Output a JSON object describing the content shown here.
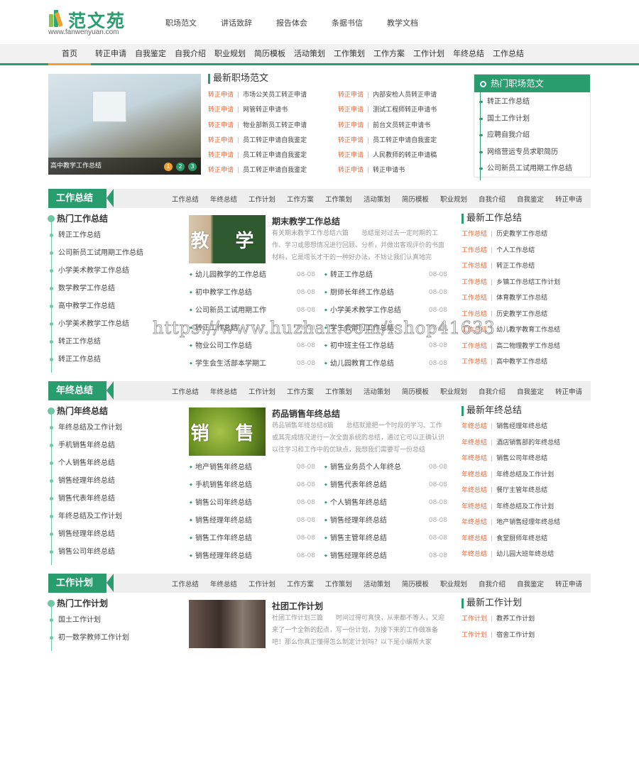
{
  "header": {
    "logo_text": "范文苑",
    "logo_url": "www.fanwenyuan.com",
    "top_nav": [
      "职场范文",
      "讲话致辞",
      "报告体会",
      "条据书信",
      "教学文档"
    ]
  },
  "main_nav": [
    "首页",
    "转正申请",
    "自我鉴定",
    "自我介绍",
    "职业规划",
    "简历模板",
    "活动策划",
    "工作策划",
    "工作方案",
    "工作计划",
    "年终总结",
    "工作总结"
  ],
  "slider": {
    "caption": "高中教学工作总结",
    "dots": [
      "1",
      "2",
      "3"
    ],
    "active_dot": 1
  },
  "latest_career": {
    "title": "最新职场范文",
    "rows": [
      {
        "tag": "转正申请",
        "text": "市场公关员工转正申请"
      },
      {
        "tag": "转正申请",
        "text": "内部安检人员转正申请"
      },
      {
        "tag": "转正申请",
        "text": "网管转正申请书"
      },
      {
        "tag": "转正申请",
        "text": "测试工程师转正申请书"
      },
      {
        "tag": "转正申请",
        "text": "物业部新员工转正申请"
      },
      {
        "tag": "转正申请",
        "text": "前台文员转正申请书"
      },
      {
        "tag": "转正申请",
        "text": "员工转正申请自我鉴定"
      },
      {
        "tag": "转正申请",
        "text": "员工转正申请自我鉴定"
      },
      {
        "tag": "转正申请",
        "text": "员工转正申请自我鉴定"
      },
      {
        "tag": "转正申请",
        "text": "人民教师的转正申请稿"
      },
      {
        "tag": "转正申请",
        "text": "员工转正申请自我鉴定"
      },
      {
        "tag": "转正申请",
        "text": "转正申请书"
      }
    ]
  },
  "hot_career": {
    "title": "热门职场范文",
    "items": [
      "转正工作总结",
      "国土工作计划",
      "应聘自我介绍",
      "网络营运专员求职简历",
      "公司新员工试用期工作总结"
    ]
  },
  "section_links": [
    "工作总结",
    "年终总结",
    "工作计划",
    "工作方案",
    "工作策划",
    "活动策划",
    "简历模板",
    "职业规划",
    "自我介绍",
    "自我鉴定",
    "转正申请"
  ],
  "sections": [
    {
      "label": "工作总结",
      "hot_title": "热门工作总结",
      "hot_items": [
        "转正工作总结",
        "公司新员工试用期工作总结",
        "小学美术教学工作总结",
        "数学教学工作总结",
        "高中教学工作总结",
        "小学美术教学工作总结",
        "转正工作总结",
        "转正工作总结"
      ],
      "feature": {
        "thumb_text": "教 学",
        "title": "期末教学工作总结",
        "desc": "有关期末教学工作总结六篇　　总结是对过去一定时期的工作、学习或思想情况进行回顾、分析，并做出客观评价的书面材料，它是增长才干的一种好办法，不妨让我们认真地完"
      },
      "items": [
        {
          "text": "幼儿园教学的工作总结",
          "date": "08-08"
        },
        {
          "text": "转正工作总结",
          "date": "08-08"
        },
        {
          "text": "初中教学工作总结",
          "date": "08-08"
        },
        {
          "text": "厨师长年终工作总结",
          "date": "08-08"
        },
        {
          "text": "公司新员工试用期工作",
          "date": "08-08"
        },
        {
          "text": "小学美术教学工作总结",
          "date": "08-08"
        },
        {
          "text": "转正工作总结",
          "date": "08-08"
        },
        {
          "text": "学生会部门工作总结",
          "date": "08-08"
        },
        {
          "text": "物业公司工作总结",
          "date": "08-08"
        },
        {
          "text": "初中班主任工作总结",
          "date": "08-08"
        },
        {
          "text": "学生会生活部本学期工",
          "date": "08-08"
        },
        {
          "text": "幼儿园教育工作总结",
          "date": "08-08"
        }
      ],
      "newest_title": "最新工作总结",
      "newest": [
        {
          "tag": "工作总结",
          "text": "历史教学工作总结"
        },
        {
          "tag": "工作总结",
          "text": "个人工作总结"
        },
        {
          "tag": "工作总结",
          "text": "转正工作总结"
        },
        {
          "tag": "工作总结",
          "text": "乡镇工作总结工作计划"
        },
        {
          "tag": "工作总结",
          "text": "体育教学工作总结"
        },
        {
          "tag": "工作总结",
          "text": "历史教学工作总结"
        },
        {
          "tag": "工作总结",
          "text": "幼儿教学教育工作总结"
        },
        {
          "tag": "工作总结",
          "text": "高二物理教学工作总结"
        },
        {
          "tag": "工作总结",
          "text": "高中教学工作总结"
        }
      ]
    },
    {
      "label": "年终总结",
      "hot_title": "热门年终总结",
      "hot_items": [
        "年终总结及工作计划",
        "手机销售年终总结",
        "个人销售年终总结",
        "销售经理年终总结",
        "销售代表年终总结",
        "年终总结及工作计划",
        "销售经理年终总结",
        "销售公司年终总结"
      ],
      "feature": {
        "thumb_text": "销 售",
        "title": "药品销售年终总结",
        "desc": "药品销售年终总结8篇　　总结就是把一个时段的学习、工作或其完成情况进行一次全面系统的总结，通过它可以正确认识以往学习和工作中的优缺点，我想我们需要写一份总结"
      },
      "items": [
        {
          "text": "地产销售年终总结",
          "date": "08-08"
        },
        {
          "text": "销售业务员个人年终总",
          "date": "08-08"
        },
        {
          "text": "手机销售年终总结",
          "date": "08-08"
        },
        {
          "text": "销售代表年终总结",
          "date": "08-08"
        },
        {
          "text": "销售公司年终总结",
          "date": "08-08"
        },
        {
          "text": "个人销售年终总结",
          "date": "08-08"
        },
        {
          "text": "销售经理年终总结",
          "date": "08-08"
        },
        {
          "text": "销售经理年终总结",
          "date": "08-08"
        },
        {
          "text": "销售工作年终总结",
          "date": "08-08"
        },
        {
          "text": "销售主管年终总结",
          "date": "08-08"
        },
        {
          "text": "销售经理年终总结",
          "date": "08-08"
        },
        {
          "text": "销售经理年终总结",
          "date": "08-08"
        }
      ],
      "newest_title": "最新年终总结",
      "newest": [
        {
          "tag": "年终总结",
          "text": "销售经理年终总结"
        },
        {
          "tag": "年终总结",
          "text": "酒店销售部的年终总结"
        },
        {
          "tag": "年终总结",
          "text": "销售公司年终总结"
        },
        {
          "tag": "年终总结",
          "text": "年终总结及工作计划"
        },
        {
          "tag": "年终总结",
          "text": "餐厅主管年终总结"
        },
        {
          "tag": "年终总结",
          "text": "年终总结及工作计划"
        },
        {
          "tag": "年终总结",
          "text": "地产销售经理年终总结"
        },
        {
          "tag": "年终总结",
          "text": "食堂厨师年终总结"
        },
        {
          "tag": "年终总结",
          "text": "幼儿园大班年终总结"
        }
      ]
    },
    {
      "label": "工作计划",
      "hot_title": "热门工作计划",
      "hot_items": [
        "国土工作计划",
        "初一数学教师工作计划"
      ],
      "feature": {
        "thumb_text": "",
        "title": "社团工作计划",
        "desc": "社团工作计划三篇　　时间过得可真快，从来都不等人，又迎来了一个全新的起点，写一份计划，为接下来的工作做准备吧！那么你真正懂得怎么制定计划吗？以下是小编帮大家"
      },
      "items": [],
      "newest_title": "最新工作计划",
      "newest": [
        {
          "tag": "工作计划",
          "text": "教养工作计划"
        },
        {
          "tag": "工作计划",
          "text": "宿舍工作计划"
        }
      ]
    }
  ],
  "watermark": "https://www.huzhan.com/ishop41633",
  "colors": {
    "brand": "#2a9d6f",
    "accent": "#f0a030",
    "tag": "#e8683a"
  }
}
